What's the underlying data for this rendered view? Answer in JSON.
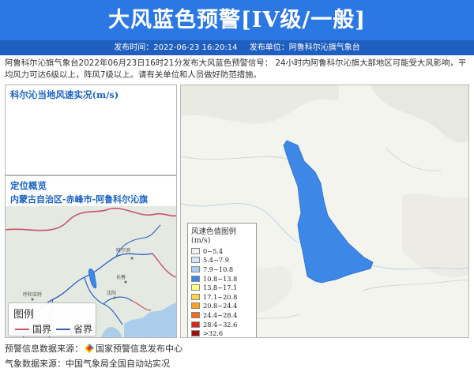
{
  "header": {
    "title": "大风蓝色预警[IV级/一般]",
    "publish_time": "发布时间：2022-06-23 16:20:14",
    "publisher": "发布单位：阿鲁科尔沁旗气象台"
  },
  "description": "阿鲁科尔沁旗气象台2022年06月23日16时21分发布大风蓝色预警信号： 24小时内阿鲁科尔沁旗大部地区可能受大风影响，平均风力可达6级以上，阵风7级以上。请有关单位和人员做好防范措施。",
  "wind_panel": {
    "title": "科尔沁当地风速实况(m/s)"
  },
  "location_panel": {
    "title": "定位概览",
    "region": "内蒙古自治区-赤峰市-阿鲁科尔沁旗",
    "map_labels": [
      "哈尔滨",
      "长春",
      "沈阳",
      "呼和浩特"
    ],
    "legend": {
      "title": "图例",
      "items": [
        {
          "label": "国界",
          "color": "#c7546a"
        },
        {
          "label": "省界",
          "color": "#2d5fc4"
        }
      ]
    }
  },
  "main_map": {
    "region_fill": "#3d87e6",
    "legend": {
      "title": "风速色值图例 (m/s)",
      "items": [
        {
          "label": "0~5.4",
          "color": "#f2f2f2"
        },
        {
          "label": "5.4~7.9",
          "color": "#d3e6fb"
        },
        {
          "label": "7.9~10.8",
          "color": "#a7ccf5"
        },
        {
          "label": "10.8~13.8",
          "color": "#3d87e6"
        },
        {
          "label": "13.8~17.1",
          "color": "#ffff80"
        },
        {
          "label": "17.1~20.8",
          "color": "#ffd24d"
        },
        {
          "label": "20.8~24.4",
          "color": "#ffa020"
        },
        {
          "label": "24.4~28.4",
          "color": "#f26a1d"
        },
        {
          "label": "28.4~32.6",
          "color": "#d9261c"
        },
        {
          "label": ">32.6",
          "color": "#9b0f0f"
        }
      ]
    }
  },
  "footer": {
    "warning_source_label": "预警信息数据来源：",
    "warning_source": "国家预警信息发布中心",
    "weather_source": "气象数据来源：中国气象局全国自动站实况"
  }
}
